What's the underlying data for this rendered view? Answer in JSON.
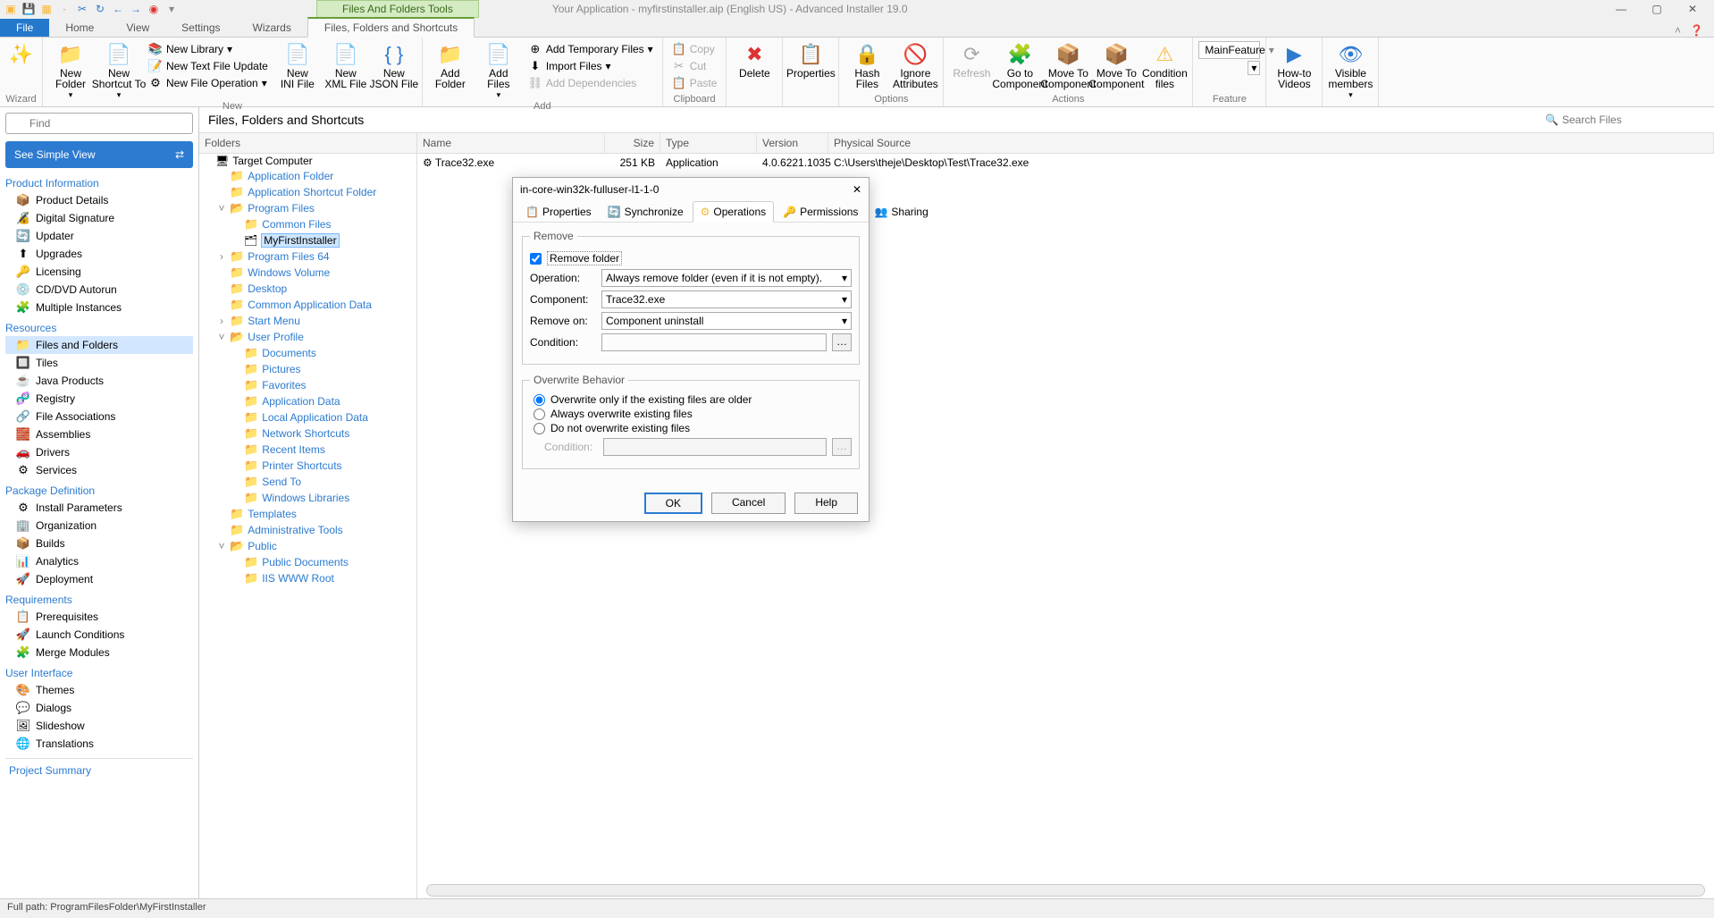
{
  "titlebar": {
    "tools_tab": "Files And Folders Tools",
    "title": "Your Application - myfirstinstaller.aip (English US) - Advanced Installer 19.0"
  },
  "ribbon_tabs": {
    "file": "File",
    "home": "Home",
    "view": "View",
    "settings": "Settings",
    "wizards": "Wizards",
    "ffs": "Files, Folders and Shortcuts"
  },
  "ribbon": {
    "wizard": {
      "label": "Wizard"
    },
    "new": {
      "group": "New",
      "new_folder": "New\nFolder",
      "new_shortcut": "New\nShortcut To",
      "new_library": "New Library",
      "new_text_update": "New Text File Update",
      "new_file_op": "New File Operation",
      "new_ini": "New\nINI File",
      "new_xml": "New\nXML File",
      "new_json": "New\nJSON File"
    },
    "add": {
      "group": "Add",
      "add_folder": "Add\nFolder",
      "add_files": "Add\nFiles",
      "add_temp": "Add Temporary Files",
      "import_files": "Import Files",
      "add_deps": "Add Dependencies"
    },
    "clipboard": {
      "group": "Clipboard",
      "copy": "Copy",
      "cut": "Cut",
      "paste": "Paste"
    },
    "delete": "Delete",
    "properties": "Properties",
    "options": {
      "group": "Options",
      "hash": "Hash\nFiles",
      "ignore": "Ignore\nAttributes"
    },
    "actions": {
      "group": "Actions",
      "refresh": "Refresh",
      "goto": "Go to\nComponent",
      "moveto": "Move To\nComponent",
      "movefrom": "Move To\nComponent",
      "cond_files": "Condition\nfiles"
    },
    "feature": {
      "group": "Feature",
      "value": "MainFeature"
    },
    "howto": "How-to\nVideos",
    "visible": "Visible\nmembers"
  },
  "sidebar": {
    "find_ph": "Find",
    "simple_view": "See Simple View",
    "cat_product": "Product Information",
    "product_items": [
      "Product Details",
      "Digital Signature",
      "Updater",
      "Upgrades",
      "Licensing",
      "CD/DVD Autorun",
      "Multiple Instances"
    ],
    "cat_resources": "Resources",
    "resource_items": [
      "Files and Folders",
      "Tiles",
      "Java Products",
      "Registry",
      "File Associations",
      "Assemblies",
      "Drivers",
      "Services"
    ],
    "cat_pkgdef": "Package Definition",
    "pkgdef_items": [
      "Install Parameters",
      "Organization",
      "Builds",
      "Analytics",
      "Deployment"
    ],
    "cat_req": "Requirements",
    "req_items": [
      "Prerequisites",
      "Launch Conditions",
      "Merge Modules"
    ],
    "cat_ui": "User Interface",
    "ui_items": [
      "Themes",
      "Dialogs",
      "Slideshow",
      "Translations"
    ],
    "project_summary": "Project Summary"
  },
  "content": {
    "title": "Files, Folders and Shortcuts",
    "search_ph": "Search Files",
    "tree_head": "Folders",
    "tree": {
      "root": "Target Computer",
      "app_folder": "Application Folder",
      "app_shortcut": "Application Shortcut Folder",
      "program_files": "Program Files",
      "common_files": "Common Files",
      "myfirst": "MyFirstInstaller",
      "pf64": "Program Files 64",
      "win_vol": "Windows Volume",
      "desktop": "Desktop",
      "common_app_data": "Common Application Data",
      "start_menu": "Start Menu",
      "user_profile": "User Profile",
      "documents": "Documents",
      "pictures": "Pictures",
      "favorites": "Favorites",
      "app_data": "Application Data",
      "local_app_data": "Local Application Data",
      "net_shortcuts": "Network Shortcuts",
      "recent": "Recent Items",
      "printer": "Printer Shortcuts",
      "sendto": "Send To",
      "win_lib": "Windows Libraries",
      "templates": "Templates",
      "admin_tools": "Administrative Tools",
      "public": "Public",
      "pub_docs": "Public Documents",
      "iis": "IIS WWW Root"
    },
    "cols": {
      "name": "Name",
      "size": "Size",
      "type": "Type",
      "version": "Version",
      "source": "Physical Source"
    },
    "row": {
      "name": "Trace32.exe",
      "size": "251 KB",
      "type": "Application",
      "version": "4.0.6221.1035",
      "source": "C:\\Users\\theje\\Desktop\\Test\\Trace32.exe"
    }
  },
  "dialog": {
    "title": "in-core-win32k-fulluser-l1-1-0",
    "tabs": {
      "props": "Properties",
      "sync": "Synchronize",
      "ops": "Operations",
      "perm": "Permissions",
      "share": "Sharing"
    },
    "remove": {
      "legend": "Remove",
      "chk": "Remove folder",
      "op_label": "Operation:",
      "op_val": "Always remove folder (even if it is not empty).",
      "comp_label": "Component:",
      "comp_val": "Trace32.exe",
      "remon_label": "Remove on:",
      "remon_val": "Component uninstall",
      "cond_label": "Condition:"
    },
    "overwrite": {
      "legend": "Overwrite Behavior",
      "r1": "Overwrite only if the existing files are older",
      "r2": "Always overwrite existing files",
      "r3": "Do not overwrite existing files",
      "cond": "Condition:"
    },
    "btns": {
      "ok": "OK",
      "cancel": "Cancel",
      "help": "Help"
    }
  },
  "statusbar": "Full path: ProgramFilesFolder\\MyFirstInstaller"
}
